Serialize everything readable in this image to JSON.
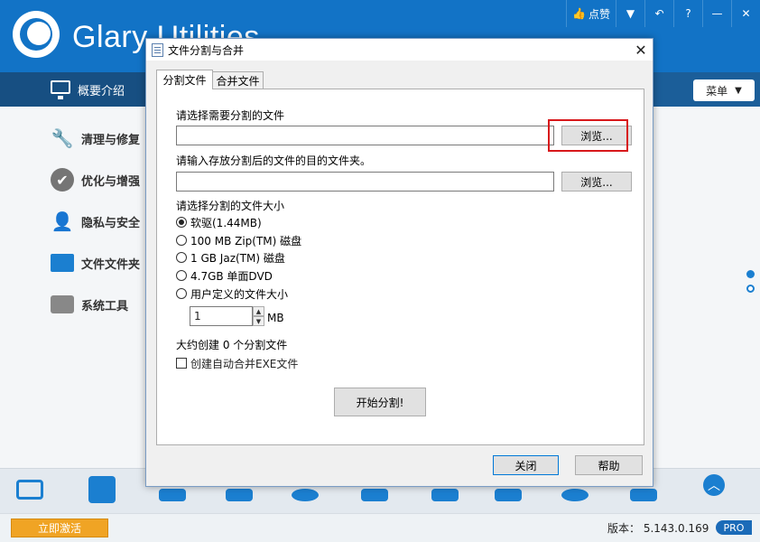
{
  "app": {
    "title": "Glary Utilities",
    "topbar": {
      "like_label": "点赞",
      "icons": [
        "thumbs-up-icon",
        "shirt-icon",
        "undo-icon",
        "help-icon",
        "minimize-icon",
        "close-icon"
      ]
    },
    "nav": {
      "overview_label": "概要介绍",
      "menu_label": "菜单"
    },
    "sidebar": {
      "items": [
        {
          "label": "清理与修复",
          "icon": "broom-icon"
        },
        {
          "label": "优化与增强",
          "icon": "checkmark-icon"
        },
        {
          "label": "隐私与安全",
          "icon": "user-lock-icon"
        },
        {
          "label": "文件文件夹",
          "icon": "folder-icon"
        },
        {
          "label": "系统工具",
          "icon": "toolbox-icon"
        }
      ]
    },
    "status": {
      "activate_label": "立即激活",
      "version_text": "版本： 5.143.0.169",
      "pro_label": "PRO"
    },
    "colors": {
      "header_blue": "#1273c6",
      "nav_blue": "#1b5e99",
      "activate_orange": "#f0a424",
      "highlight_red": "#d8181b"
    }
  },
  "dialog": {
    "title": "文件分割与合并",
    "tabs": [
      "分割文件",
      "合并文件"
    ],
    "source_label": "请选择需要分割的文件",
    "source_value": "",
    "browse_label": "浏览...",
    "dest_label": "请输入存放分割后的文件的目的文件夹。",
    "dest_value": "",
    "size_label": "请选择分割的文件大小",
    "size_options": [
      {
        "label": "软驱(1.44MB)",
        "checked": true
      },
      {
        "label": "100 MB Zip(TM) 磁盘",
        "checked": false
      },
      {
        "label": "1 GB Jaz(TM) 磁盘",
        "checked": false
      },
      {
        "label": "4.7GB 单面DVD",
        "checked": false
      },
      {
        "label": "用户定义的文件大小",
        "checked": false
      }
    ],
    "custom_size_value": "1",
    "custom_size_unit": "MB",
    "estimate_text": "大约创建 0 个分割文件",
    "exe_checkbox_label": "创建自动合并EXE文件",
    "start_label": "开始分割!",
    "close_label": "关闭",
    "help_label": "帮助"
  }
}
